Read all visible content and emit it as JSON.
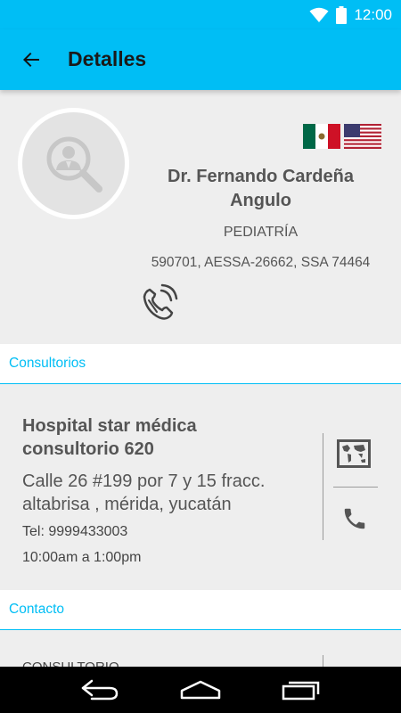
{
  "status_bar": {
    "time": "12:00"
  },
  "app_bar": {
    "title": "Detalles"
  },
  "doctor": {
    "name": "Dr. Fernando Cardeña Angulo",
    "specialty": "PEDIATRÍA",
    "license": "590701, AESSA-26662, SSA 74464"
  },
  "sections": {
    "offices_label": "Consultorios",
    "contact_label": "Contacto"
  },
  "office": {
    "name": "Hospital star médica consultorio 620",
    "address": "Calle 26 #199 por 7 y 15 fracc. altabrisa , mérida, yucatán",
    "tel": "Tel: 9999433003",
    "hours": "10:00am a 1:00pm"
  },
  "contact": {
    "first_label": "CONSULTORIO"
  },
  "colors": {
    "accent": "#00bef5",
    "background": "#eeeeee",
    "text": "#555555"
  },
  "icons": [
    "wifi-icon",
    "battery-icon",
    "back-arrow-icon",
    "doctor-search-icon",
    "mexico-flag-icon",
    "usa-flag-icon",
    "phone-ring-icon",
    "map-icon",
    "phone-icon",
    "nav-back-icon",
    "nav-home-icon",
    "nav-recents-icon"
  ]
}
